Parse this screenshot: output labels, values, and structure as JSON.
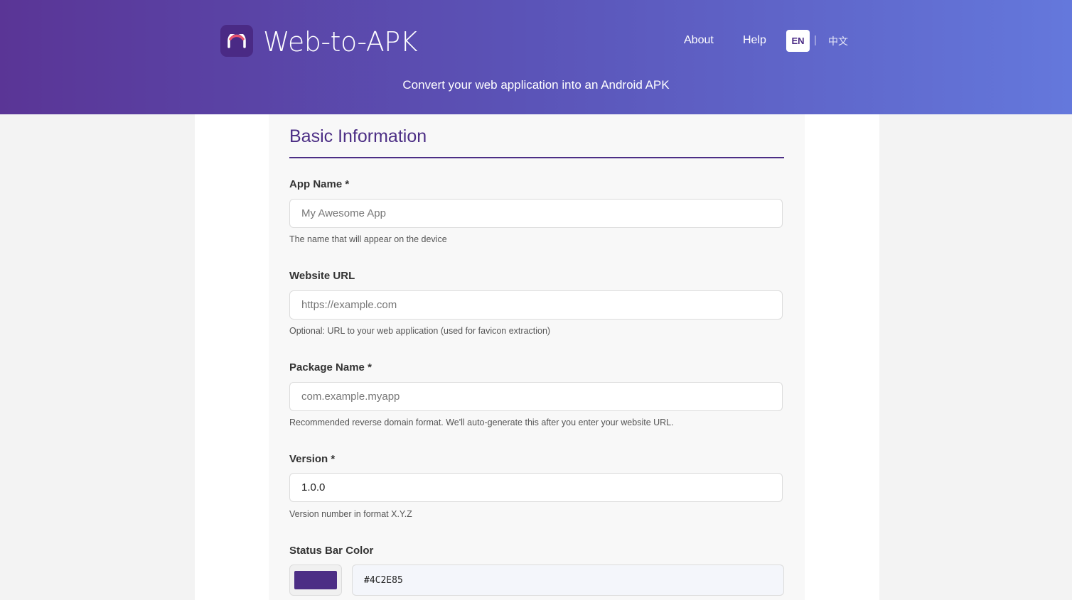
{
  "header": {
    "brand": "Web-to-APK",
    "nav": {
      "about": "About",
      "help": "Help"
    },
    "lang": {
      "en": "EN",
      "separator": "|",
      "zh": "中文"
    },
    "tagline": "Convert your web application into an Android APK"
  },
  "section": {
    "title": "Basic Information"
  },
  "fields": {
    "app_name": {
      "label": "App Name *",
      "placeholder": "My Awesome App",
      "hint": "The name that will appear on the device"
    },
    "website_url": {
      "label": "Website URL",
      "placeholder": "https://example.com",
      "hint": "Optional: URL to your web application (used for favicon extraction)"
    },
    "package_name": {
      "label": "Package Name *",
      "placeholder": "com.example.myapp",
      "hint": "Recommended reverse domain format. We'll auto-generate this after you enter your website URL."
    },
    "version": {
      "label": "Version *",
      "value": "1.0.0",
      "hint": "Version number in format X.Y.Z"
    },
    "status_bar_color": {
      "label": "Status Bar Color",
      "value": "#4C2E85"
    }
  },
  "colors": {
    "accent": "#4C2E85",
    "header_start": "#5a3596",
    "header_end": "#6478dc",
    "logo_arc": "#e8546f"
  }
}
